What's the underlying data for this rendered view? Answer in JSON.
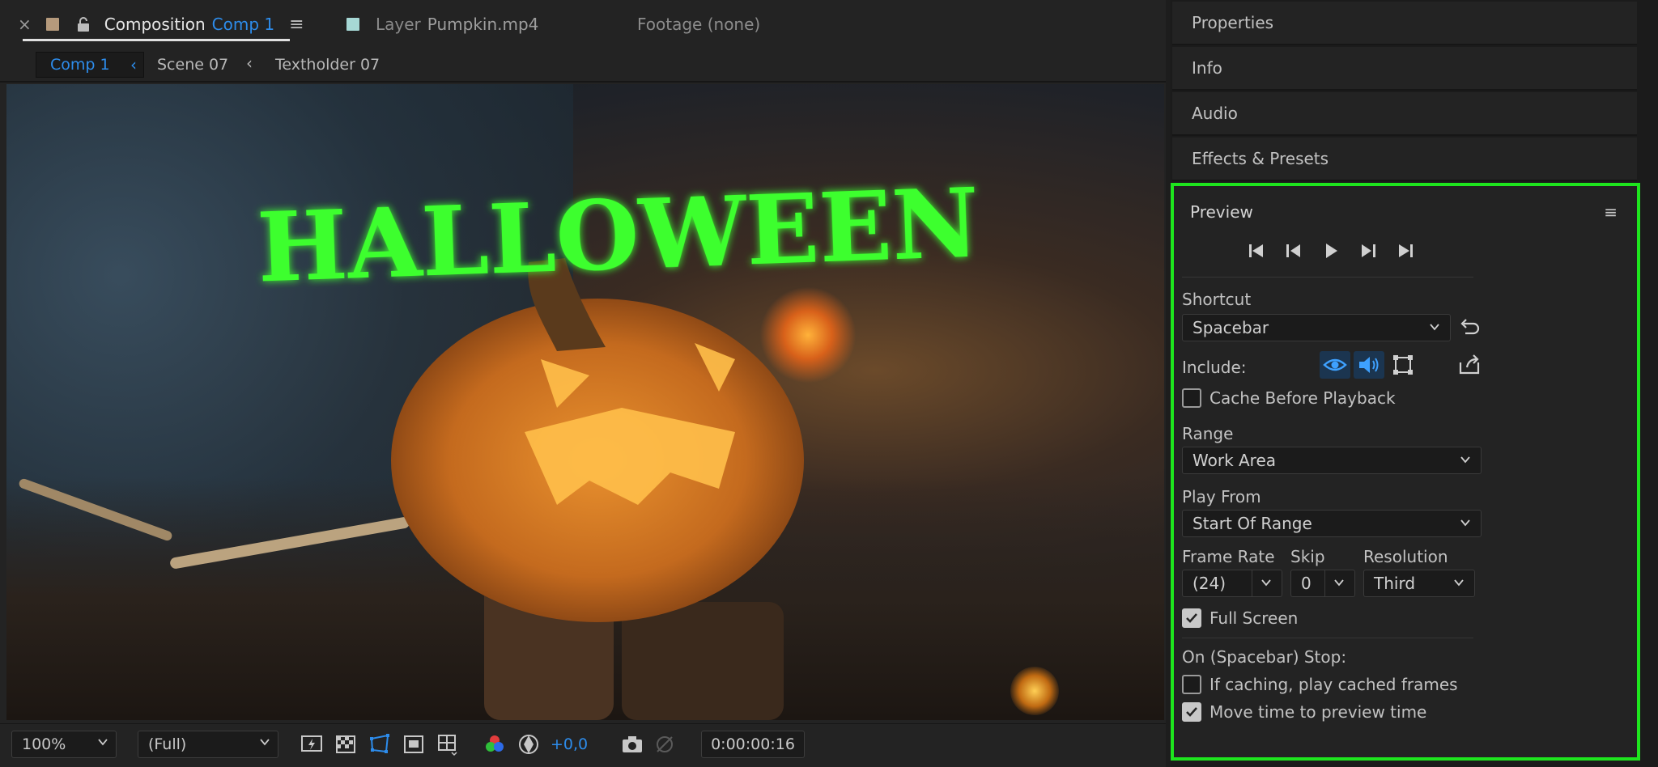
{
  "composition_panel": {
    "tabs": {
      "comp_tab_close": "×",
      "comp_tab_title": "Composition",
      "comp_tab_name": "Comp 1",
      "comp_tab_menu": "≡",
      "layer_tab_title": "Layer",
      "layer_tab_name": "Pumpkin.mp4",
      "footage_tab": "Footage (none)"
    },
    "breadcrumbs": [
      "Comp 1",
      "Scene 07",
      "Textholder 07"
    ],
    "viewer_title_text": "HALLOWEEN",
    "viewer_bar": {
      "zoom": "100%",
      "resolution": "(Full)",
      "exposure": "+0,0",
      "timecode": "0:00:00:16"
    }
  },
  "right_panels": {
    "collapsed": [
      "Properties",
      "Info",
      "Audio",
      "Effects & Presets"
    ],
    "preview": {
      "title": "Preview",
      "menu": "≡",
      "shortcut_label": "Shortcut",
      "shortcut_value": "Spacebar",
      "include_label": "Include:",
      "cache_before_playback": {
        "label": "Cache Before Playback",
        "checked": false
      },
      "range_label": "Range",
      "range_value": "Work Area",
      "play_from_label": "Play From",
      "play_from_value": "Start Of Range",
      "frame_rate_label": "Frame Rate",
      "frame_rate_value": "(24)",
      "skip_label": "Skip",
      "skip_value": "0",
      "resolution_label": "Resolution",
      "resolution_value": "Third",
      "full_screen": {
        "label": "Full Screen",
        "checked": true
      },
      "on_stop_label": "On (Spacebar) Stop:",
      "if_caching": {
        "label": "If caching, play cached frames",
        "checked": false
      },
      "move_time": {
        "label": "Move time to preview time",
        "checked": true
      }
    }
  },
  "colors": {
    "accent_blue": "#2d8ceb",
    "highlight_green": "#1ee51e",
    "halloween_green": "#3dff2e",
    "panel_bg": "#232323"
  }
}
